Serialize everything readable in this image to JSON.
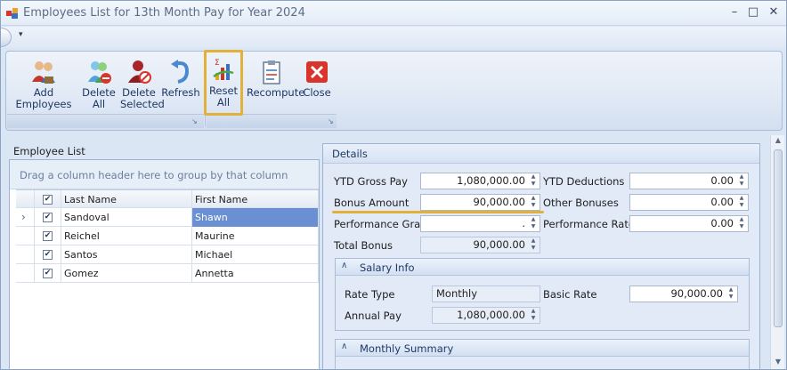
{
  "window": {
    "title": "Employees List for 13th Month Pay for Year 2024",
    "minimize": "–",
    "maximize": "□",
    "close": "✕"
  },
  "qat": {
    "dropdown": "▾"
  },
  "ribbon": {
    "add_employees": "Add Employees",
    "delete_all_1": "Delete",
    "delete_all_2": "All",
    "delete_selected_1": "Delete",
    "delete_selected_2": "Selected",
    "refresh": "Refresh",
    "reset_all_1": "Reset",
    "reset_all_2": "All",
    "recompute": "Recompute",
    "close": "Close",
    "launcher": "↘"
  },
  "employee_list": {
    "title": "Employee List",
    "group_hint": "Drag a column header here to group by that column",
    "columns": {
      "last_name": "Last Name",
      "first_name": "First Name"
    },
    "rows": [
      {
        "last": "Sandoval",
        "first": "Shawn"
      },
      {
        "last": "Reichel",
        "first": "Maurine"
      },
      {
        "last": "Santos",
        "first": "Michael"
      },
      {
        "last": "Gomez",
        "first": "Annetta"
      }
    ],
    "check": "✔",
    "row_indicator": "›"
  },
  "details": {
    "title": "Details",
    "ytd_gross_pay_label": "YTD Gross Pay",
    "ytd_gross_pay": "1,080,000.00",
    "ytd_deductions_label": "YTD Deductions",
    "ytd_deductions": "0.00",
    "bonus_amount_label": "Bonus Amount",
    "bonus_amount": "90,000.00",
    "other_bonuses_label": "Other Bonuses",
    "other_bonuses": "0.00",
    "performance_grade_label": "Performance Grade",
    "performance_grade": ".",
    "performance_rate_label": "Performance Rate",
    "performance_rate": "0.00",
    "total_bonus_label": "Total Bonus",
    "total_bonus": "90,000.00",
    "salary_info": {
      "title": "Salary Info",
      "rate_type_label": "Rate Type",
      "rate_type": "Monthly",
      "basic_rate_label": "Basic Rate",
      "basic_rate": "90,000.00",
      "annual_pay_label": "Annual Pay",
      "annual_pay": "1,080,000.00"
    },
    "monthly_summary": {
      "title": "Monthly Summary"
    },
    "collapse_icon": "∧"
  },
  "spin": {
    "up": "▲",
    "down": "▼"
  },
  "colors": {
    "highlight": "#e3b13a",
    "selection": "#6a8fd3"
  }
}
